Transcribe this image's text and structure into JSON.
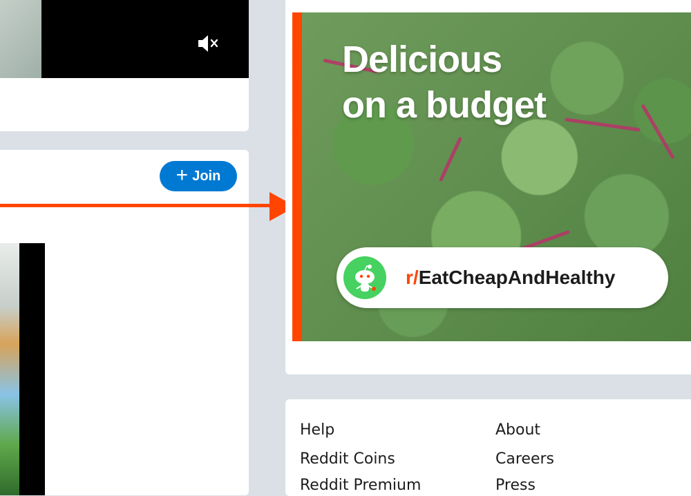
{
  "video": {
    "mute_icon": "speaker-muted-icon"
  },
  "post": {
    "join_label": "Join",
    "join_icon": "plus-icon"
  },
  "ad": {
    "headline_line1": "Delicious",
    "headline_line2": "on a budget",
    "subreddit_prefix": "r/",
    "subreddit_name": "EatCheapAndHealthy",
    "avatar_icon": "snoo-icon",
    "accent_color": "#ff4500"
  },
  "footer": {
    "col1": [
      "Help",
      "Reddit Coins",
      "Reddit Premium"
    ],
    "col2": [
      "About",
      "Careers",
      "Press"
    ]
  },
  "colors": {
    "page_bg": "#dae0e6",
    "join_blue": "#0079d3",
    "annotation_orange": "#ff4500",
    "avatar_green": "#46d160"
  }
}
